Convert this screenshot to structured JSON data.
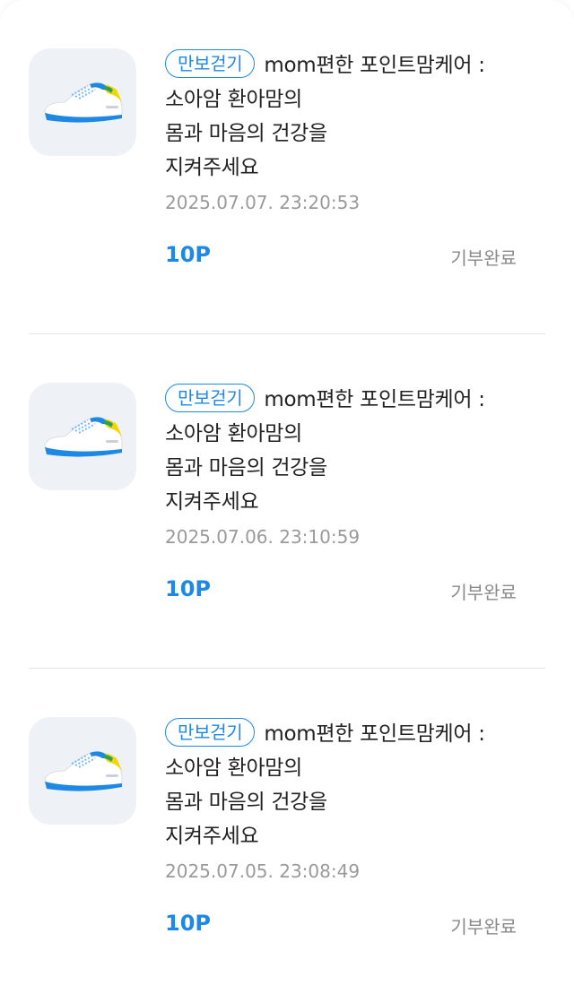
{
  "donations": [
    {
      "tag": "만보걷기",
      "title_line1": "mom편한 포인트맘케어 :",
      "title_line2": "소아암 환아맘의",
      "title_line3": "몸과 마음의 건강을",
      "title_line4": "지켜주세요",
      "date": "2025.07.07. 23:20:53",
      "points": "10P",
      "status": "기부완료",
      "icon": "sneaker-icon"
    },
    {
      "tag": "만보걷기",
      "title_line1": "mom편한 포인트맘케어 :",
      "title_line2": "소아암 환아맘의",
      "title_line3": "몸과 마음의 건강을",
      "title_line4": "지켜주세요",
      "date": "2025.07.06. 23:10:59",
      "points": "10P",
      "status": "기부완료",
      "icon": "sneaker-icon"
    },
    {
      "tag": "만보걷기",
      "title_line1": "mom편한 포인트맘케어 :",
      "title_line2": "소아암 환아맘의",
      "title_line3": "몸과 마음의 건강을",
      "title_line4": "지켜주세요",
      "date": "2025.07.05. 23:08:49",
      "points": "10P",
      "status": "기부완료",
      "icon": "sneaker-icon"
    }
  ],
  "colors": {
    "accent": "#1e88e5",
    "muted": "#8a8a8a",
    "thumb_bg": "#eef2f6"
  }
}
